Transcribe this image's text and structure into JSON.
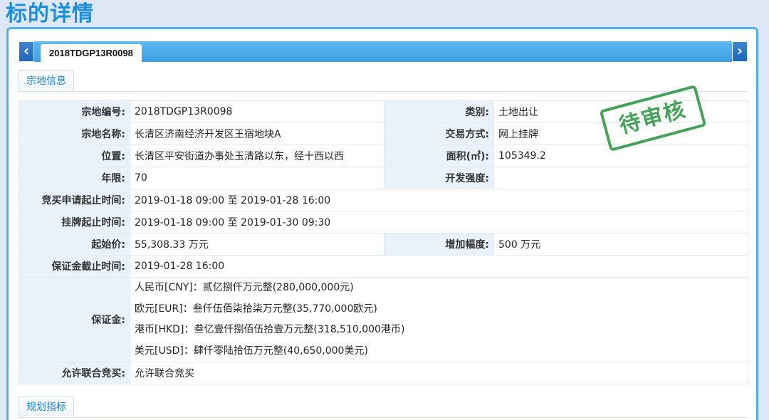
{
  "page_title": "标的详情",
  "tab": {
    "label": "2018TDGP13R0098",
    "prev_icon": "‹",
    "next_icon": "›"
  },
  "section_land": "宗地信息",
  "section_plan": "规划指标",
  "stamp": "待审核",
  "rows": {
    "parcel_no": {
      "label": "宗地编号:",
      "value": "2018TDGP13R0098"
    },
    "category": {
      "label": "类别:",
      "value": "土地出让"
    },
    "parcel_name": {
      "label": "宗地名称:",
      "value": "长清区济南经济开发区王宿地块A"
    },
    "trade_mode": {
      "label": "交易方式:",
      "value": "网上挂牌"
    },
    "location": {
      "label": "位置:",
      "value": "长清区平安街道办事处玉清路以东，经十西以西"
    },
    "area": {
      "label": "面积(㎡):",
      "value": "105349.2"
    },
    "term": {
      "label": "年限:",
      "value": "70"
    },
    "intensity": {
      "label": "开发强度:",
      "value": ""
    },
    "apply_period": {
      "label": "竞买申请起止时间:",
      "value": "2019-01-18 09:00 至 2019-01-28 16:00"
    },
    "listing_period": {
      "label": "挂牌起止时间:",
      "value": "2019-01-18 09:00 至 2019-01-30 09:30"
    },
    "start_price": {
      "label": "起始价:",
      "value": "55,308.33 万元"
    },
    "increment": {
      "label": "增加幅度:",
      "value": "500 万元"
    },
    "deposit_deadline": {
      "label": "保证金截止时间:",
      "value": "2019-01-28 16:00"
    },
    "deposit": {
      "label": "保证金:",
      "lines": [
        "人民币[CNY]：贰亿捌仟万元整(280,000,000元)",
        "欧元[EUR]：叁仟伍佰柒拾柒万元整(35,770,000欧元)",
        "港币[HKD]：叁亿壹仟捌佰伍拾壹万元整(318,510,000港币)",
        "美元[USD]：肆仟零陆拾伍万元整(40,650,000美元)"
      ]
    },
    "joint_bid": {
      "label": "允许联合竞买:",
      "value": "允许联合竞买"
    }
  },
  "colors": {
    "accent": "#1a8fe0",
    "label_bg": "#e9f1fb",
    "stamp": "#2f9a45"
  }
}
